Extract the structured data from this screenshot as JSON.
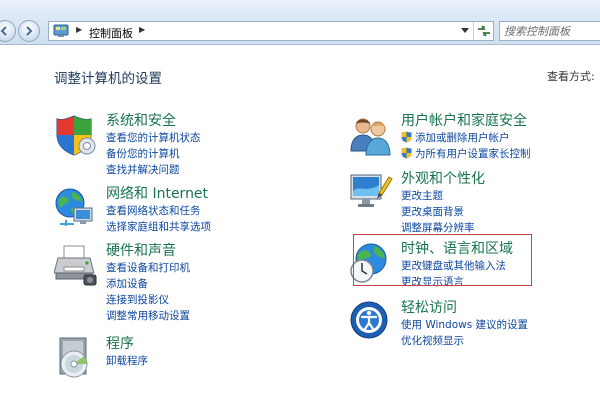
{
  "address_bar": {
    "breadcrumb": "控制面板"
  },
  "search": {
    "placeholder": "搜索控制面板"
  },
  "main": {
    "title": "调整计算机的设置",
    "view_by_label": "查看方式:"
  },
  "categories": [
    {
      "heading": "系统和安全",
      "icon": "shield-icon",
      "links": [
        "查看您的计算机状态",
        "备份您的计算机",
        "查找并解决问题"
      ]
    },
    {
      "heading": "网络和 Internet",
      "icon": "network-globe-icon",
      "links": [
        "查看网络状态和任务",
        "选择家庭组和共享选项"
      ]
    },
    {
      "heading": "硬件和声音",
      "icon": "printer-icon",
      "links": [
        "查看设备和打印机",
        "添加设备",
        "连接到投影仪",
        "调整常用移动设置"
      ]
    },
    {
      "heading": "程序",
      "icon": "programs-disc-icon",
      "links": [
        "卸载程序"
      ]
    },
    {
      "heading": "用户帐户和家庭安全",
      "icon": "users-icon",
      "links": [
        "添加或删除用户帐户",
        "为所有用户设置家长控制"
      ]
    },
    {
      "heading": "外观和个性化",
      "icon": "monitor-icon",
      "links": [
        "更改主题",
        "更改桌面背景",
        "调整屏幕分辨率"
      ]
    },
    {
      "heading": "时钟、语言和区域",
      "icon": "clock-globe-icon",
      "links": [
        "更改键盘或其他输入法",
        "更改显示语言"
      ]
    },
    {
      "heading": "轻松访问",
      "icon": "ease-of-access-icon",
      "links": [
        "使用 Windows 建议的设置",
        "优化视频显示"
      ]
    }
  ],
  "colors": {
    "heading_green": "#18754c",
    "link_blue": "#0d47a1",
    "highlight_red": "#c8424a"
  }
}
